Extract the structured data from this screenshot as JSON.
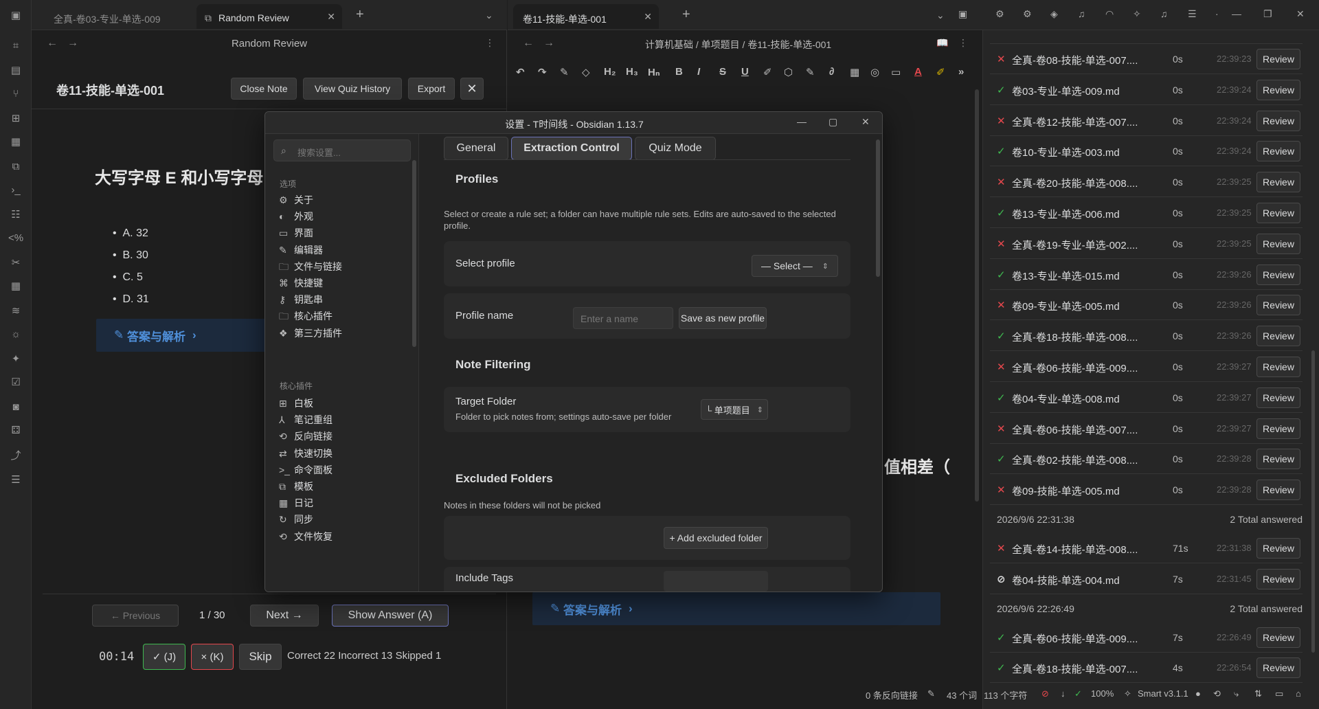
{
  "left": {
    "tabs": [
      {
        "label": "全真-卷03-专业-单选-009"
      },
      {
        "label": "Random Review"
      }
    ],
    "header_title": "Random Review",
    "note_title": "卷11-技能-单选-001",
    "actions": {
      "close_note": "Close Note",
      "view_history": "View Quiz History",
      "export": "Export"
    },
    "question": "大写字母 E 和小写字母 e 的 ASCII 码值相差（ ）。",
    "options": [
      "A. 32",
      "B. 30",
      "C. 5",
      "D. 31"
    ],
    "answer_link": "答案与解析",
    "nav": {
      "previous": "← Previous",
      "page": "1 / 30",
      "next": "Next →",
      "show_answer": "Show Answer (A)"
    },
    "timer": "00:14",
    "correct_btn": "✓ (J)",
    "incorrect_btn": "× (K)",
    "skip_btn": "Skip",
    "stats": "Correct 22 Incorrect 13 Skipped 1"
  },
  "middle": {
    "tab": "卷11-技能-单选-001",
    "breadcrumb": "计算机基础 / 单项题目 / 卷11-技能-单选-001",
    "toolbar": [
      "↶",
      "↷",
      "✎",
      "◇",
      "H₂",
      "H₃",
      "Hₙ",
      "B",
      "I",
      "S",
      "U",
      "✐",
      "⬡",
      "✎",
      "📎",
      "▦",
      "◎",
      "▭",
      "A",
      "✐",
      "»"
    ],
    "big_text_fragment": "值相差（",
    "answer_link": "答案与解析"
  },
  "modal": {
    "title": "设置 - T时间线 - Obsidian 1.13.7",
    "search_placeholder": "搜索设置...",
    "section_options": "选项",
    "options_items": [
      {
        "icon": "⚙",
        "label": "关于"
      },
      {
        "icon": "◐",
        "label": "外观"
      },
      {
        "icon": "▭",
        "label": "界面"
      },
      {
        "icon": "✎",
        "label": "编辑器"
      },
      {
        "icon": "🗀",
        "label": "文件与链接"
      },
      {
        "icon": "⌘",
        "label": "快捷键"
      },
      {
        "icon": "⚷",
        "label": "钥匙串"
      },
      {
        "icon": "🗀",
        "label": "核心插件"
      },
      {
        "icon": "❖",
        "label": "第三方插件"
      }
    ],
    "section_core": "核心插件",
    "core_items": [
      {
        "icon": "⊞",
        "label": "白板"
      },
      {
        "icon": "⅄",
        "label": "笔记重组"
      },
      {
        "icon": "⟲",
        "label": "反向链接"
      },
      {
        "icon": "⇄",
        "label": "快速切换"
      },
      {
        "icon": ">_",
        "label": "命令面板"
      },
      {
        "icon": "⧉",
        "label": "模板"
      },
      {
        "icon": "▦",
        "label": "日记"
      },
      {
        "icon": "↻",
        "label": "同步"
      },
      {
        "icon": "⟲",
        "label": "文件恢复"
      }
    ],
    "tabs": {
      "general": "General",
      "extraction": "Extraction Control",
      "quiz": "Quiz Mode"
    },
    "profiles_heading": "Profiles",
    "profiles_desc": "Select or create a rule set; a folder can have multiple rule sets. Edits are auto-saved to the selected profile.",
    "select_profile_label": "Select profile",
    "select_profile_value": "— Select —",
    "profile_name_label": "Profile name",
    "profile_name_placeholder": "Enter a name",
    "save_profile": "Save as new profile",
    "note_filtering_heading": "Note Filtering",
    "target_folder_label": "Target Folder",
    "target_folder_desc": "Folder to pick notes from; settings auto-save per folder",
    "target_folder_value": "└ 单项题目",
    "excluded_heading": "Excluded Folders",
    "excluded_desc": "Notes in these folders will not be picked",
    "add_excluded": "+ Add excluded folder",
    "include_tags": "Include Tags"
  },
  "right": {
    "rows": [
      {
        "mark": "bad",
        "name": "全真-卷08-技能-单选-007....",
        "dur": "0s",
        "time": "22:39:23",
        "btn": "Review"
      },
      {
        "mark": "ok",
        "name": "卷03-专业-单选-009.md",
        "dur": "0s",
        "time": "22:39:24",
        "btn": "Review"
      },
      {
        "mark": "bad",
        "name": "全真-卷12-技能-单选-007....",
        "dur": "0s",
        "time": "22:39:24",
        "btn": "Review"
      },
      {
        "mark": "ok",
        "name": "卷10-专业-单选-003.md",
        "dur": "0s",
        "time": "22:39:24",
        "btn": "Review"
      },
      {
        "mark": "bad",
        "name": "全真-卷20-技能-单选-008....",
        "dur": "0s",
        "time": "22:39:25",
        "btn": "Review"
      },
      {
        "mark": "ok",
        "name": "卷13-专业-单选-006.md",
        "dur": "0s",
        "time": "22:39:25",
        "btn": "Review"
      },
      {
        "mark": "bad",
        "name": "全真-卷19-专业-单选-002....",
        "dur": "0s",
        "time": "22:39:25",
        "btn": "Review"
      },
      {
        "mark": "ok",
        "name": "卷13-专业-单选-015.md",
        "dur": "0s",
        "time": "22:39:26",
        "btn": "Review"
      },
      {
        "mark": "bad",
        "name": "卷09-专业-单选-005.md",
        "dur": "0s",
        "time": "22:39:26",
        "btn": "Review"
      },
      {
        "mark": "ok",
        "name": "全真-卷18-技能-单选-008....",
        "dur": "0s",
        "time": "22:39:26",
        "btn": "Review"
      },
      {
        "mark": "bad",
        "name": "全真-卷06-技能-单选-009....",
        "dur": "0s",
        "time": "22:39:27",
        "btn": "Review"
      },
      {
        "mark": "ok",
        "name": "卷04-专业-单选-008.md",
        "dur": "0s",
        "time": "22:39:27",
        "btn": "Review"
      },
      {
        "mark": "bad",
        "name": "全真-卷06-技能-单选-007....",
        "dur": "0s",
        "time": "22:39:27",
        "btn": "Review"
      },
      {
        "mark": "ok",
        "name": "全真-卷02-技能-单选-008....",
        "dur": "0s",
        "time": "22:39:28",
        "btn": "Review"
      },
      {
        "mark": "bad",
        "name": "卷09-技能-单选-005.md",
        "dur": "0s",
        "time": "22:39:28",
        "btn": "Review"
      }
    ],
    "group1": {
      "date": "2026/9/6 22:31:38",
      "total": "2 Total answered"
    },
    "group1_rows": [
      {
        "mark": "bad",
        "name": "全真-卷14-技能-单选-008....",
        "dur": "71s",
        "time": "22:31:38",
        "btn": "Review"
      },
      {
        "mark": "skip",
        "name": "卷04-技能-单选-004.md",
        "dur": "7s",
        "time": "22:31:45",
        "btn": "Review"
      }
    ],
    "group2": {
      "date": "2026/9/6 22:26:49",
      "total": "2 Total answered"
    },
    "group2_rows": [
      {
        "mark": "ok",
        "name": "全真-卷06-技能-单选-009....",
        "dur": "7s",
        "time": "22:26:49",
        "btn": "Review"
      },
      {
        "mark": "ok",
        "name": "全真-卷18-技能-单选-007....",
        "dur": "4s",
        "time": "22:26:54",
        "btn": "Review"
      }
    ]
  },
  "statusbar": {
    "backlinks": "0 条反向链接",
    "words": "43 个词",
    "chars": "113 个字符",
    "zoom": "100%",
    "smart": "Smart v3.1.1"
  }
}
